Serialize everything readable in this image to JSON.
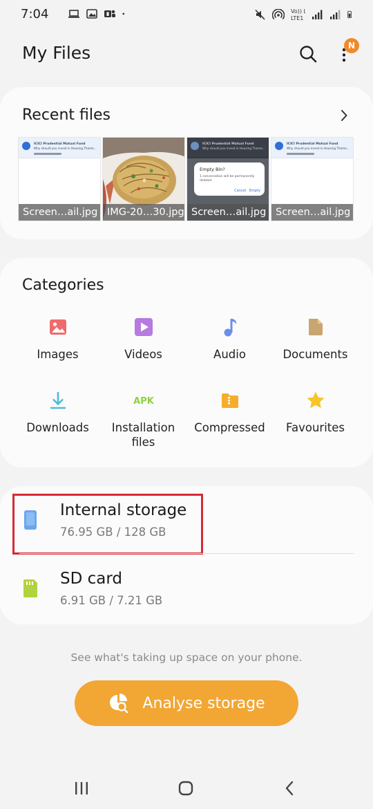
{
  "status_bar": {
    "time": "7:04",
    "left_icons": [
      "laptop-icon",
      "image-icon",
      "teams-icon",
      "dot-icon"
    ],
    "right_icons": [
      "mute-icon",
      "hotspot-icon",
      "volte-lte-icon",
      "signal-icon",
      "signal-icon",
      "battery-icon"
    ],
    "volte_top": "Vo)) LTE",
    "volte_bottom": "LTE1"
  },
  "header": {
    "title": "My Files",
    "search_icon": "search-icon",
    "more_icon": "more-vertical-icon",
    "badge": "N"
  },
  "recent": {
    "title": "Recent files",
    "chevron_icon": "chevron-right-icon",
    "files": [
      {
        "name": "Screen…ail.jpg",
        "kind": "screenshot"
      },
      {
        "name": "IMG-20…30.jpg",
        "kind": "photo"
      },
      {
        "name": "Screen…ail.jpg",
        "kind": "screenshot-dialog"
      },
      {
        "name": "Screen…ail.jpg",
        "kind": "screenshot"
      }
    ],
    "thumb_text": {
      "sender": "ICICI Prudential Mutual Fund",
      "subject": "Why should you invest in Housing Theme…",
      "dialog_title": "Empty Bin?",
      "dialog_text": "1 conversation will be permanently deleted.",
      "dialog_cancel": "Cancel",
      "dialog_empty": "Empty"
    }
  },
  "categories": {
    "title": "Categories",
    "items": [
      {
        "label": "Images",
        "icon": "image-icon",
        "color": "#ef6b6b"
      },
      {
        "label": "Videos",
        "icon": "video-icon",
        "color": "#b57be0"
      },
      {
        "label": "Audio",
        "icon": "music-note-icon",
        "color": "#6b8fe8"
      },
      {
        "label": "Documents",
        "icon": "document-icon",
        "color": "#c9a571"
      },
      {
        "label": "Downloads",
        "icon": "download-icon",
        "color": "#4dbbd9"
      },
      {
        "label": "Installation files",
        "icon": "apk-icon",
        "color": "#8cd43c",
        "icon_text": "APK"
      },
      {
        "label": "Compressed",
        "icon": "folder-zip-icon",
        "color": "#f6ad2c"
      },
      {
        "label": "Favourites",
        "icon": "star-icon",
        "color": "#f7c52a"
      }
    ]
  },
  "storage": {
    "internal": {
      "name": "Internal storage",
      "size": "76.95 GB / 128 GB",
      "icon": "phone-icon",
      "color": "#6aa6ee",
      "highlighted": true
    },
    "sd": {
      "name": "SD card",
      "size": "6.91 GB / 7.21 GB",
      "icon": "sd-card-icon",
      "color": "#b2d23e"
    }
  },
  "hint": "See what's taking up space on your phone.",
  "analyse_button": {
    "label": "Analyse storage",
    "icon": "analyse-icon",
    "color": "#f2a634"
  },
  "nav": {
    "recents_icon": "recents-icon",
    "home_icon": "home-icon",
    "back_icon": "back-icon"
  }
}
